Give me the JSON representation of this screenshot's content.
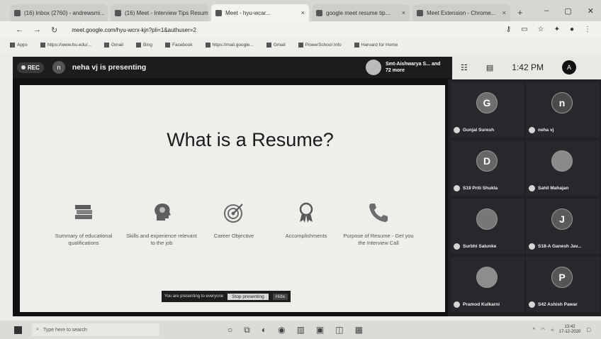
{
  "browser": {
    "tabs": [
      {
        "label": "(16) Inbox (2760) - andrewsmi..."
      },
      {
        "label": "(16) Meet - Interview Tips Resume..."
      },
      {
        "label": "Meet - hyu-wcar..."
      },
      {
        "label": "google meet resume tip..."
      },
      {
        "label": "Meet Extension - Chrome..."
      }
    ],
    "url": "meet.google.com/hyu-wcrx-kjn?pli=1&authuser=2",
    "bookmarks": [
      "Apps",
      "https://www.bu.edu/...",
      "Gmail",
      "Bing",
      "Facebook",
      "https://mail.google...",
      "Gmail",
      "PowerSchool Info",
      "Harvard for Home"
    ]
  },
  "meet": {
    "rec_label": "REC",
    "presenter_initial": "n",
    "presenting_text": "neha vj is presenting",
    "pinned_text": "Smt-Aishwarya S... and 72 more",
    "clock": "1:42 PM",
    "user_initial": "A"
  },
  "slide": {
    "title": "What is a Resume?",
    "items": [
      {
        "label": "Summary of educational qualifications",
        "icon": "books-icon"
      },
      {
        "label": "Skills and experience relevant to the job",
        "icon": "head-icon"
      },
      {
        "label": "Career Objective",
        "icon": "target-icon"
      },
      {
        "label": "Accomplishments",
        "icon": "award-icon"
      },
      {
        "label": "Purpose of Resume - Get you the Interview Call",
        "icon": "phone-icon"
      }
    ],
    "present_message": "You are presenting to everyone",
    "stop_label": "Stop presenting",
    "hide_label": "Hide"
  },
  "participants": [
    {
      "initial": "G",
      "name": "Gunjal Suresh",
      "color": "#6e6e6e"
    },
    {
      "initial": "n",
      "name": "neha vj",
      "color": "#4a4a4a"
    },
    {
      "initial": "D",
      "name": "S19 Priti Shukla",
      "color": "#666"
    },
    {
      "initial": "",
      "name": "Sahil Mahajan",
      "color": "#8a8a8a"
    },
    {
      "initial": "",
      "name": "Surbhi Salunke",
      "color": "#777"
    },
    {
      "initial": "J",
      "name": "S18-A Ganesh Jav...",
      "color": "#5a5a5a"
    },
    {
      "initial": "",
      "name": "Pramod Kulkarni",
      "color": "#8d8d8d"
    },
    {
      "initial": "P",
      "name": "S42 Ashish Pawar",
      "color": "#555"
    }
  ],
  "taskbar": {
    "search_placeholder": "Type here to search",
    "tray_time": "13:42",
    "tray_date": "17-12-2020"
  }
}
